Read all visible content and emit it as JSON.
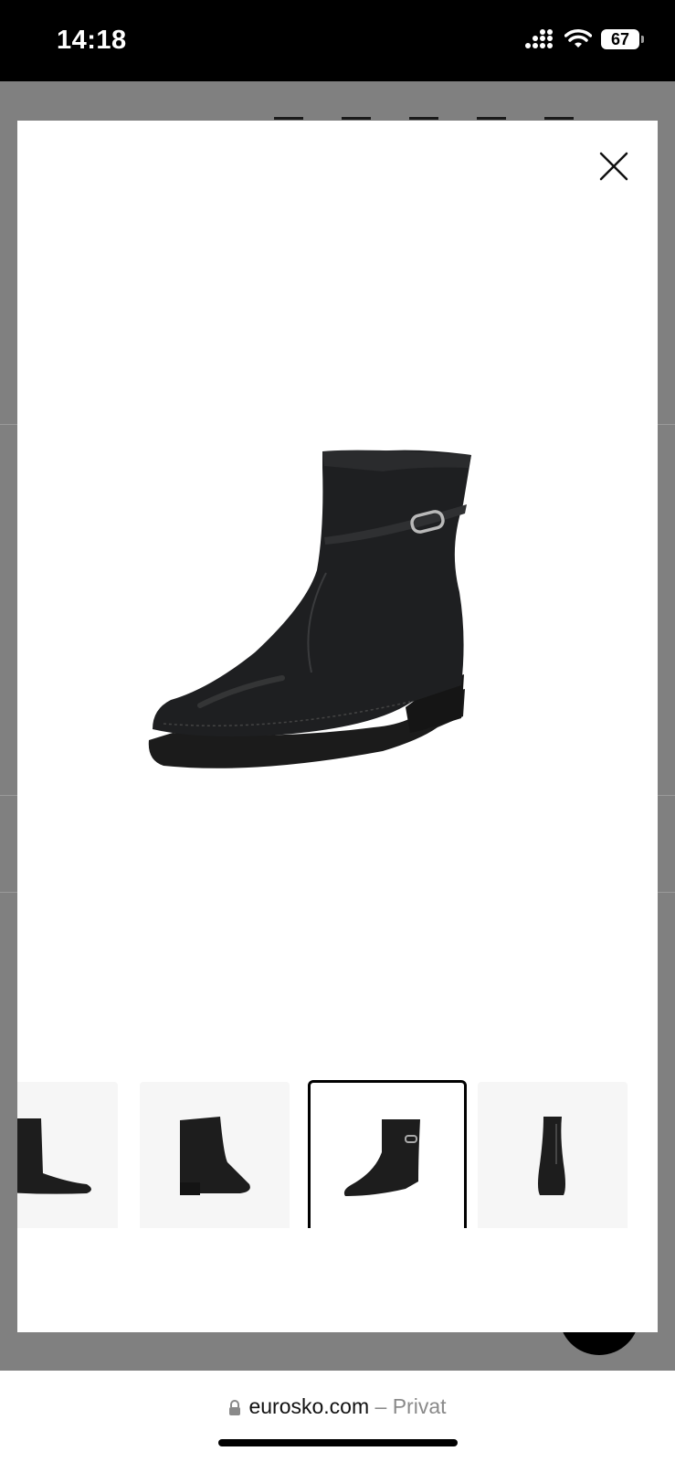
{
  "status_bar": {
    "time": "14:18",
    "battery": "67",
    "icons": [
      "cellular-signal-icon",
      "wifi-icon",
      "battery-icon"
    ]
  },
  "modal": {
    "close_icon": "close-icon",
    "main_image_alt": "black leather ankle boot",
    "thumbnails": [
      {
        "name": "thumbnail-side-view",
        "selected": false
      },
      {
        "name": "thumbnail-back-angle",
        "selected": false
      },
      {
        "name": "thumbnail-front-angle",
        "selected": true
      },
      {
        "name": "thumbnail-front-view",
        "selected": false
      }
    ]
  },
  "browser": {
    "domain": "eurosko.com",
    "separator": "–",
    "mode": "Privat",
    "lock_icon": "lock-icon"
  }
}
